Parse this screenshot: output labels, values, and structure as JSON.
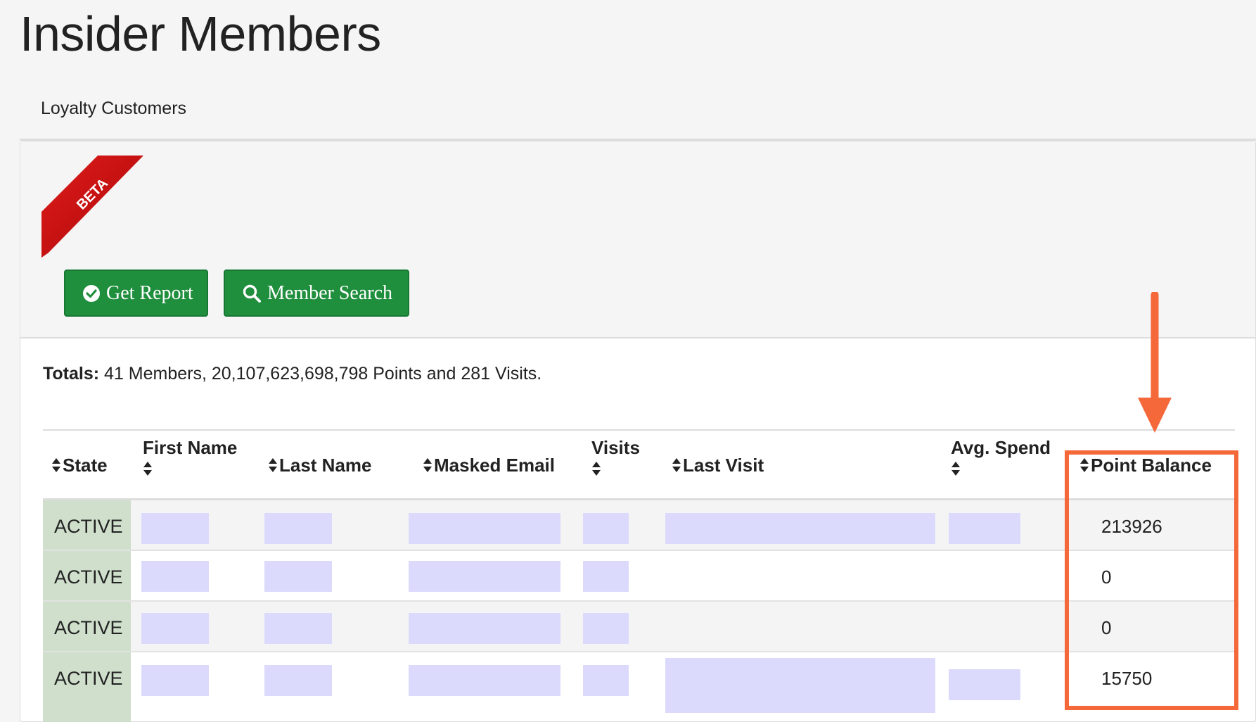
{
  "page": {
    "title": "Insider Members",
    "subtitle": "Loyalty Customers"
  },
  "ribbon": {
    "label": "BETA"
  },
  "buttons": {
    "get_report": "Get Report",
    "member_search": "Member Search"
  },
  "totals": {
    "label": "Totals:",
    "text": "41 Members, 20,107,623,698,798 Points and 281 Visits."
  },
  "table": {
    "headers": {
      "state": "State",
      "first_name": "First Name",
      "last_name": "Last Name",
      "masked_email": "Masked Email",
      "visits": "Visits",
      "last_visit": "Last Visit",
      "avg_spend": "Avg. Spend",
      "point_balance": "Point Balance"
    },
    "rows": [
      {
        "state": "ACTIVE",
        "point_balance": "213926"
      },
      {
        "state": "ACTIVE",
        "point_balance": "0"
      },
      {
        "state": "ACTIVE",
        "point_balance": "0"
      },
      {
        "state": "ACTIVE",
        "point_balance": "15750"
      }
    ]
  },
  "colors": {
    "button_green": "#1f8e3d",
    "highlight": "#f4683a",
    "state_bg": "#cfdfcc",
    "redaction": "#dcdafc"
  }
}
